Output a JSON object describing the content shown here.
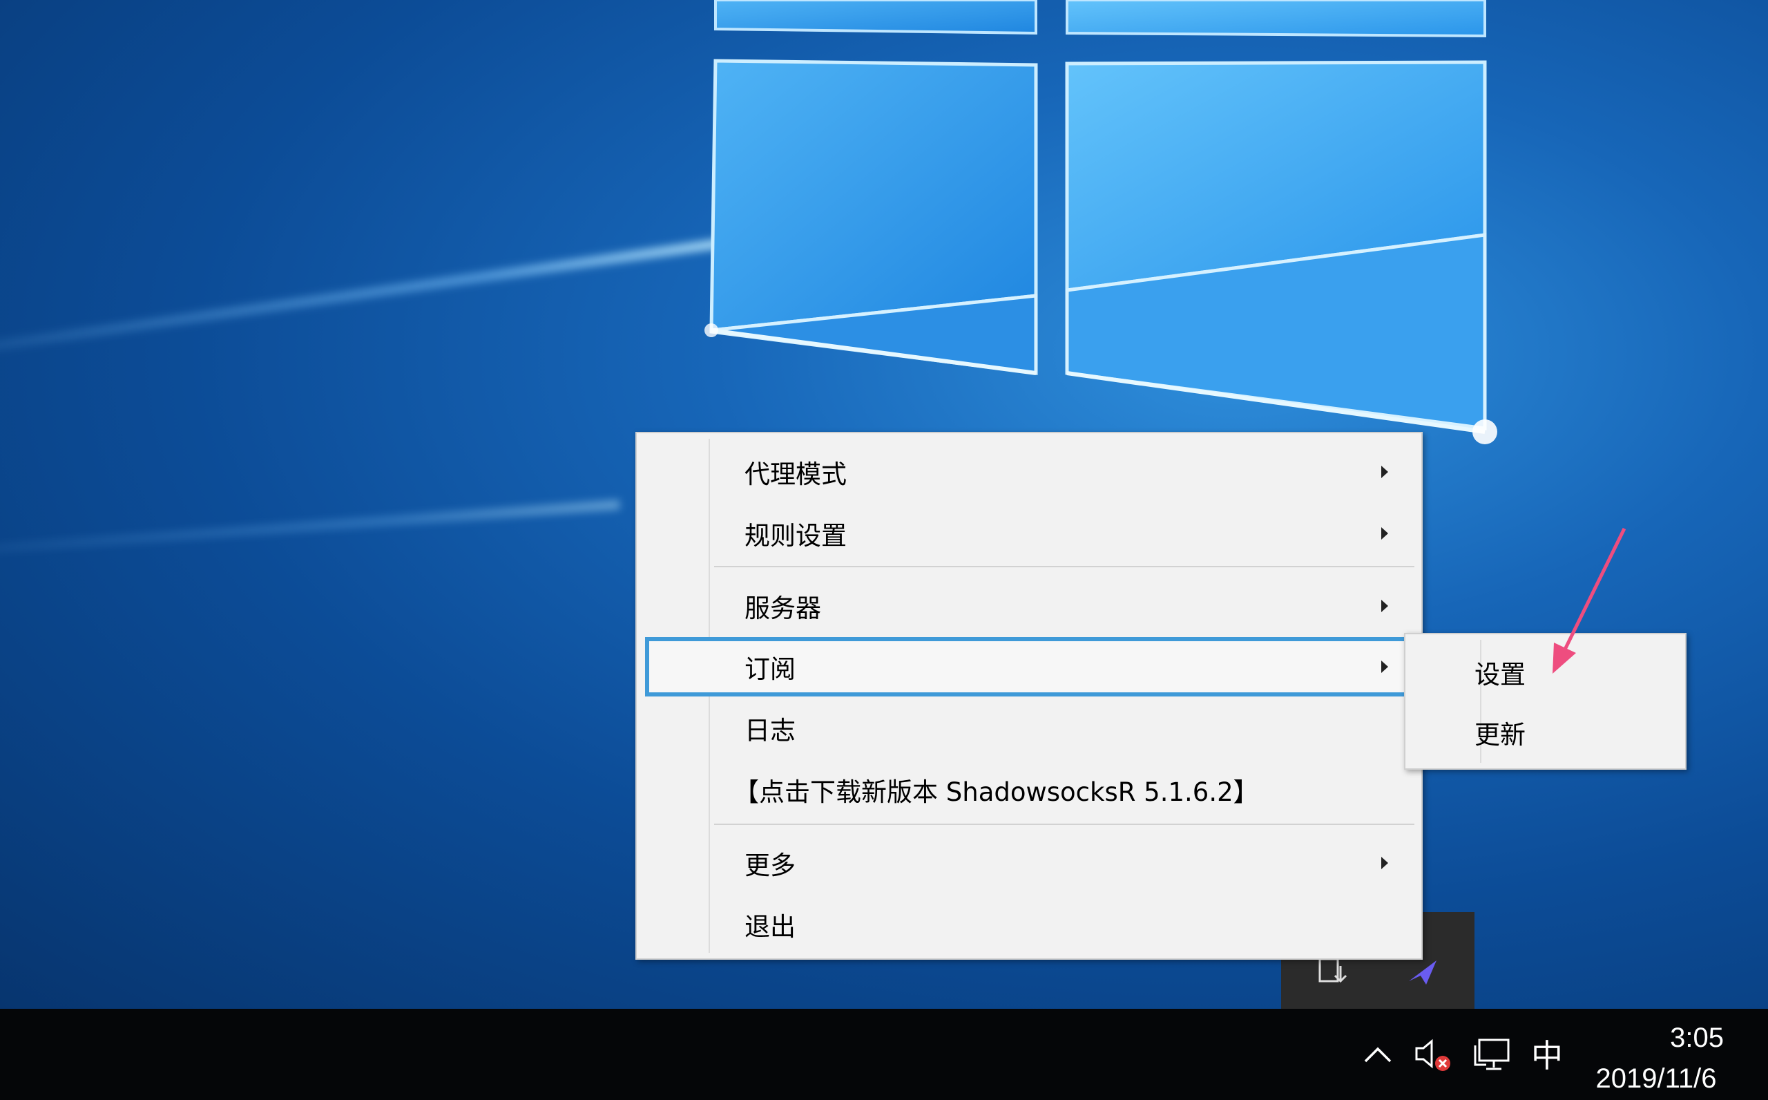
{
  "menu": {
    "items": [
      {
        "label": "代理模式",
        "has_submenu": true
      },
      {
        "label": "规则设置",
        "has_submenu": true
      },
      {
        "label": "服务器",
        "has_submenu": true
      },
      {
        "label": "订阅",
        "has_submenu": true,
        "highlighted": true
      },
      {
        "label": "日志",
        "has_submenu": false
      },
      {
        "label": "【点击下载新版本 ShadowsocksR 5.1.6.2】",
        "has_submenu": false
      },
      {
        "label": "更多",
        "has_submenu": true
      },
      {
        "label": "退出",
        "has_submenu": false
      }
    ]
  },
  "submenu": {
    "items": [
      {
        "label": "设置"
      },
      {
        "label": "更新"
      }
    ]
  },
  "taskbar": {
    "ime": "中",
    "time": "3:05",
    "date": "2019/11/6"
  },
  "colors": {
    "highlight_border": "#3f9ad8",
    "annotation_arrow": "#ee4d7f",
    "taskbar": "#050608"
  },
  "icons": {
    "tray": [
      "chevron-up-icon",
      "volume-muted-icon",
      "network-icon"
    ],
    "overflow": [
      "usb-eject-icon",
      "shadowsocks-icon"
    ]
  }
}
